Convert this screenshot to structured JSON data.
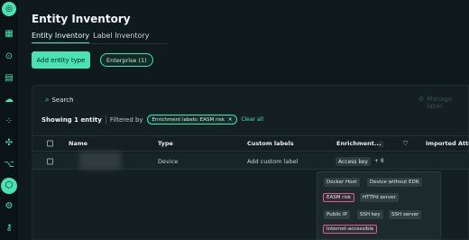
{
  "rail": {
    "icons": [
      "logo-icon",
      "grid-icon",
      "circle-arrow-icon",
      "document-icon",
      "cloud-icon",
      "nodes-icon",
      "network-icon",
      "branch-icon",
      "box-icon",
      "gear-icon",
      "key-icon"
    ]
  },
  "header": {
    "title": "Entity Inventory"
  },
  "tabs": [
    {
      "label": "Entity Inventory",
      "active": true
    },
    {
      "label": "Label Inventory",
      "active": false
    }
  ],
  "actions": {
    "add_label": "Add entity type",
    "enterprise_chip": "Enterprise (1)"
  },
  "search": {
    "label": "Search",
    "manage": "Manage label"
  },
  "filters": {
    "showing_count": "Showing 1 entity",
    "filtered_by": "Filtered by",
    "chip_label": "Enrichment labels: EASM risk",
    "chip_close": "✕",
    "clear": "Clear all"
  },
  "table": {
    "columns": [
      "Name",
      "Type",
      "Custom labels",
      "Enrichment...",
      "Imported Attri"
    ],
    "rows": [
      {
        "name": "",
        "type": "Device",
        "custom_labels": "Add custom label",
        "enrichment": "Access key",
        "more": "+ 8"
      }
    ]
  },
  "popover": {
    "tags": [
      "Docker Host",
      "Device without EDR",
      "EASM risk",
      "HTTPd server",
      "Public IP",
      "SSH key",
      "SSH server",
      "Internet-accessible"
    ]
  },
  "colors": {
    "accent": "#49e3b3",
    "highlight": "#e05a8a"
  }
}
